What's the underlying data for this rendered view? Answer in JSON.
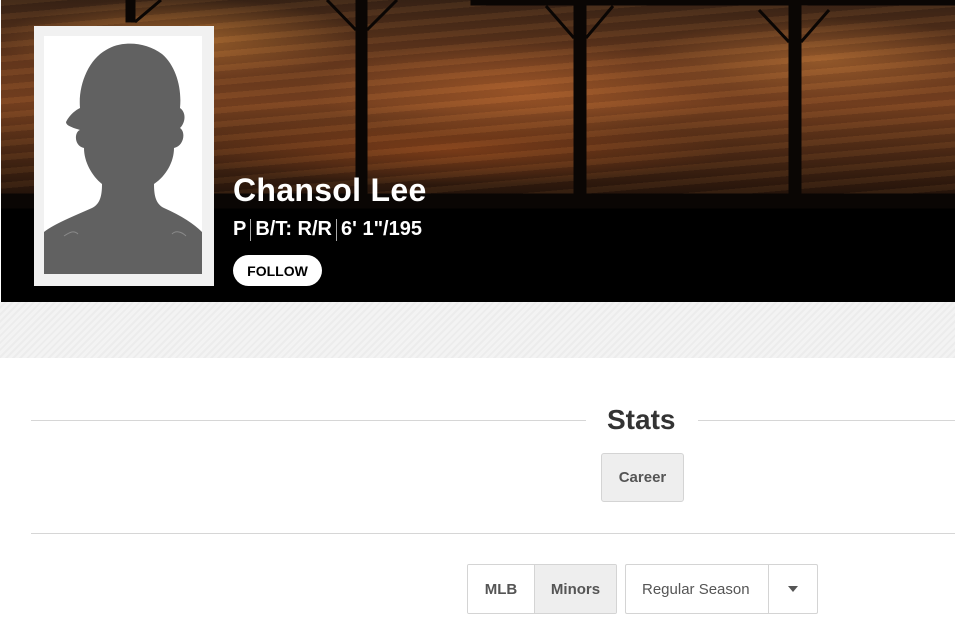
{
  "player": {
    "name": "Chansol Lee",
    "position": "P",
    "bats_throws": "B/T: R/R",
    "height_weight": "6' 1\"/195",
    "follow_label": "FOLLOW"
  },
  "icons": {
    "headshot": "silhouette-headshot-icon",
    "dropdown": "caret-down-icon"
  },
  "stats": {
    "heading": "Stats",
    "career_label": "Career",
    "level_options": [
      "MLB",
      "Minors"
    ],
    "level_selected": "Minors",
    "season_selected": "Regular Season"
  },
  "colors": {
    "header_bg": "#000000",
    "selected_bg": "#eeeeee",
    "text_dark": "#333333"
  }
}
